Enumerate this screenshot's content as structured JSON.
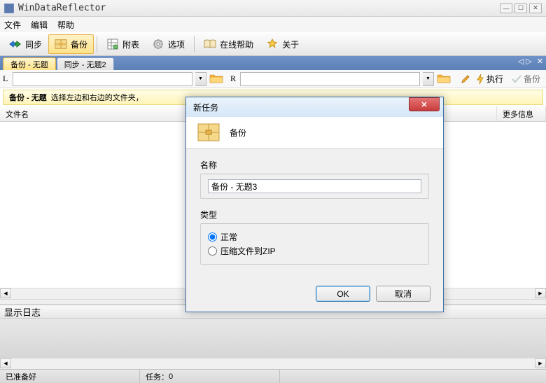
{
  "window": {
    "title": "WinDataReflector"
  },
  "menu": {
    "file": "文件",
    "edit": "编辑",
    "help": "帮助"
  },
  "toolbar": {
    "sync": "同步",
    "backup": "备份",
    "attach": "附表",
    "options": "选项",
    "onlinehelp": "在线帮助",
    "about": "关于"
  },
  "tabs": {
    "t1": "备份 - 无题",
    "t2": "同步 - 无题2",
    "navprev": "◁",
    "navnext": "▷",
    "close": "✕"
  },
  "path": {
    "L": "L",
    "R": "R",
    "run": "执行",
    "backup": "备份"
  },
  "info": {
    "title": "备份 - 无题",
    "msg": "选择左边和右边的文件夹，"
  },
  "cols": {
    "filename": "文件名",
    "more": "更多信息"
  },
  "log": {
    "header": "显示日志"
  },
  "status": {
    "ready": "已准备好",
    "tasks_label": "任务：",
    "tasks_value": "0"
  },
  "dialog": {
    "title": "新任务",
    "header": "备份",
    "name_label": "名称",
    "name_value": "备份 - 无题3",
    "type_label": "类型",
    "type_normal": "正常",
    "type_zip": "压缩文件到ZIP",
    "ok": "OK",
    "cancel": "取消"
  }
}
